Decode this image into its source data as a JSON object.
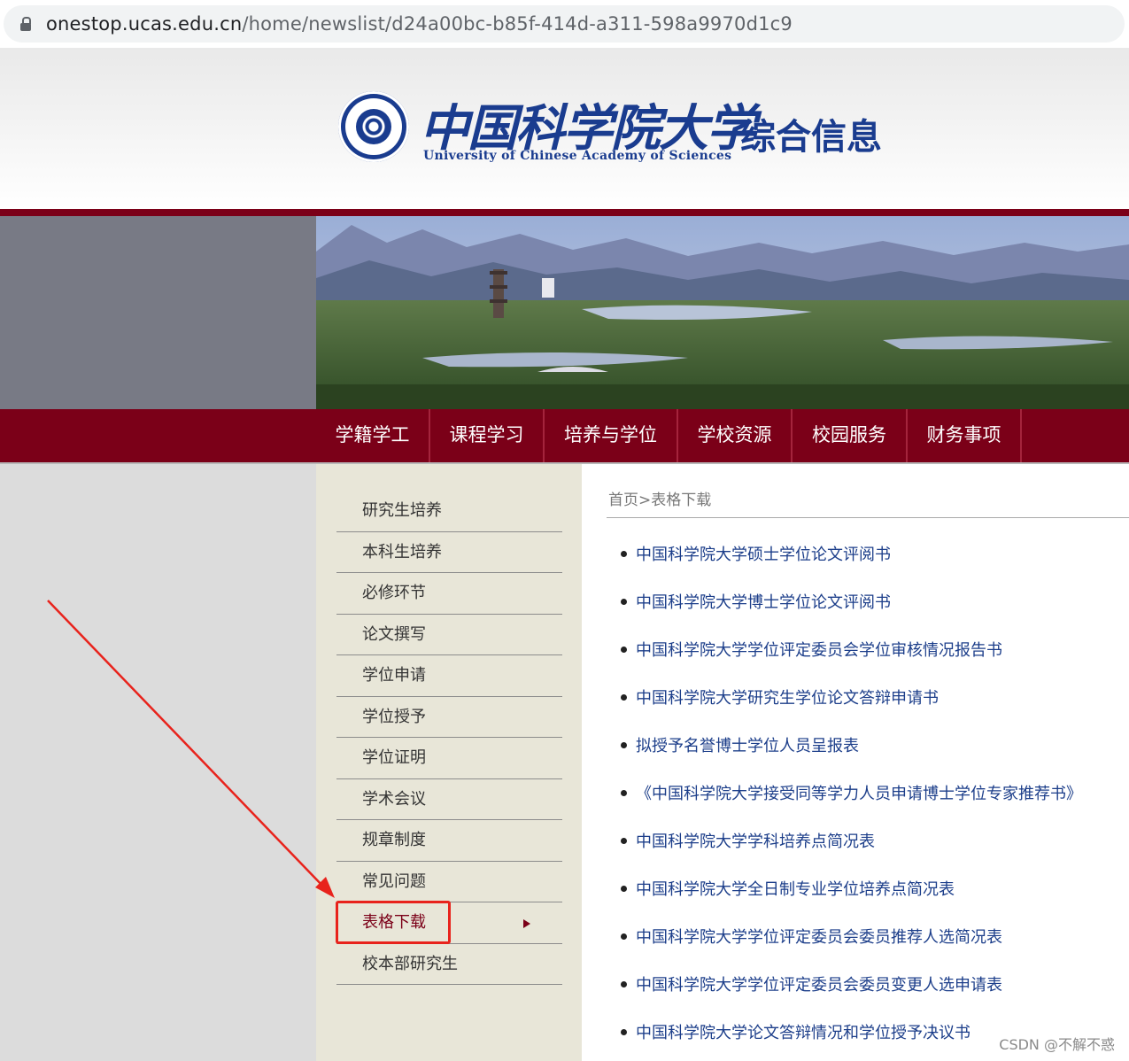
{
  "browser": {
    "url_host": "onestop.ucas.edu.cn",
    "url_path": "/home/newslist/d24a00bc-b85f-414d-a311-598a9970d1c9"
  },
  "header": {
    "logo_cn": "中国科学院大学",
    "logo_en": "University of Chinese Academy of Sciences",
    "site_title": "综合信息"
  },
  "nav": {
    "items": [
      {
        "label": "学籍学工"
      },
      {
        "label": "课程学习"
      },
      {
        "label": "培养与学位"
      },
      {
        "label": "学校资源"
      },
      {
        "label": "校园服务"
      },
      {
        "label": "财务事项"
      }
    ]
  },
  "sidebar": {
    "items": [
      {
        "label": "研究生培养"
      },
      {
        "label": "本科生培养"
      },
      {
        "label": "必修环节"
      },
      {
        "label": "论文撰写"
      },
      {
        "label": "学位申请"
      },
      {
        "label": "学位授予"
      },
      {
        "label": "学位证明"
      },
      {
        "label": "学术会议"
      },
      {
        "label": "规章制度"
      },
      {
        "label": "常见问题"
      },
      {
        "label": "表格下载"
      },
      {
        "label": "校本部研究生"
      }
    ],
    "active": "表格下载"
  },
  "main": {
    "breadcrumb": "首页>表格下载",
    "news": [
      {
        "title": "中国科学院大学硕士学位论文评阅书"
      },
      {
        "title": "中国科学院大学博士学位论文评阅书"
      },
      {
        "title": "中国科学院大学学位评定委员会学位审核情况报告书"
      },
      {
        "title": "中国科学院大学研究生学位论文答辩申请书"
      },
      {
        "title": "拟授予名誉博士学位人员呈报表"
      },
      {
        "title": "《中国科学院大学接受同等学力人员申请博士学位专家推荐书》"
      },
      {
        "title": "中国科学院大学学科培养点简况表"
      },
      {
        "title": "中国科学院大学全日制专业学位培养点简况表"
      },
      {
        "title": "中国科学院大学学位评定委员会委员推荐人选简况表"
      },
      {
        "title": "中国科学院大学学位评定委员会委员变更人选申请表"
      },
      {
        "title": "中国科学院大学论文答辩情况和学位授予决议书"
      }
    ]
  },
  "watermark": "CSDN @不解不惑",
  "colors": {
    "brand_red": "#7b0018",
    "link_blue": "#1c3e8a",
    "annotation_red": "#e8231c"
  }
}
